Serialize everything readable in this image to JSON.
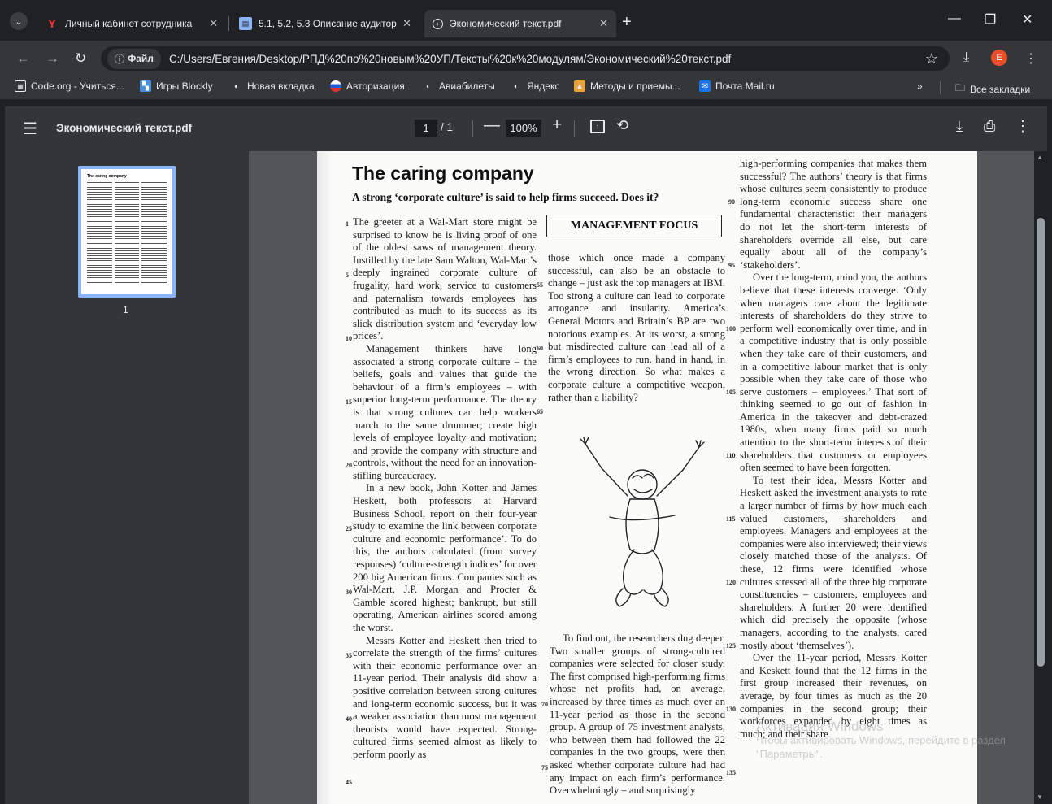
{
  "tabs": [
    {
      "label": "Личный кабинет сотрудника",
      "icon": "yandex-y-icon"
    },
    {
      "label": "5.1, 5.2, 5.3 Описание аудитор",
      "icon": "doc-icon"
    },
    {
      "label": "Экономический текст.pdf",
      "icon": "globe-icon"
    }
  ],
  "address": {
    "chip_label": "Файл",
    "url": "C:/Users/Евгения/Desktop/РПД%20по%20новым%20УП/Тексты%20к%20модулям/Экономический%20текст.pdf",
    "profile_initial": "E"
  },
  "bookmarks": [
    "Code.org - Учиться...",
    "Игры Blockly",
    "Новая вкладка",
    "Авторизация",
    "Авиабилеты",
    "Яндекс",
    "Методы и приемы...",
    "Почта Mail.ru"
  ],
  "bookmarks_more": "»",
  "bookmarks_all": "Все закладки",
  "pdf": {
    "filename": "Экономический текст.pdf",
    "page_current": "1",
    "page_total": "/ 1",
    "zoom": "100%",
    "thumb_page": "1"
  },
  "document": {
    "title": "The caring company",
    "subtitle": "A strong ‘corporate culture’ is said to help firms succeed. Does it?",
    "box_label": "MANAGEMENT FOCUS",
    "col1": [
      "The greeter at a Wal-Mart store might be surprised to know he is living proof of one of the oldest saws of management theory. Instilled by the late Sam Walton, Wal-Mart’s deeply ingrained corporate culture of frugality, hard work, service to customers and paternalism towards employees has contributed as much to its success as its slick distribution system and ‘everyday low prices’.",
      "Management thinkers have long associated a strong corporate culture – the beliefs, goals and values that guide the behaviour of a firm’s employees – with superior long-term performance. The theory is that strong cultures can help workers march to the same drummer; create high levels of employee loyalty and motivation; and provide the company with structure and controls, without the need for an innovation-stifling bureaucracy.",
      "In a new book, John Kotter and James Heskett, both professors at Harvard Business School, report on their four-year study to examine the link between corporate culture and economic performance’. To do this, the authors calculated (from survey responses) ‘culture-strength indices’ for over 200 big American firms. Companies such as Wal-Mart, J.P. Morgan and Procter & Gamble scored highest; bankrupt, but still operating, American airlines scored among the worst.",
      "Messrs Kotter and Heskett then tried to correlate the strength of the firms’ cultures with their economic performance over an 11-year period. Their analysis did show a positive correlation between strong cultures and long-term economic success, but it was a weaker association than most management theorists would have expected. Strong-cultured firms seemed almost as likely to perform poorly as"
    ],
    "col2a": "those which once made a company successful, can also be an obstacle to change – just ask the top managers at IBM. Too strong a culture can lead to corporate arrogance and insularity. America’s General Motors and Britain’s BP are two notorious examples. At its worst, a strong but misdirected culture can lead all of a firm’s employees to run, hand in hand, in the wrong direction. So what makes a corporate culture a competitive weapon, rather than a liability?",
    "col2b": "To find out, the researchers dug deeper. Two smaller groups of strong-cultured companies were selected for closer study. The first comprised high-performing firms whose net profits had, on average, increased by three times as much over an 11-year period as those in the second group. A group of 75 investment analysts, who between them had followed the 22 companies in the two groups, were then asked whether corporate culture had had any impact on each firm’s performance. Overwhelmingly – and surprisingly",
    "col3": [
      "high-performing companies that makes them successful? The authors’ theory is that firms whose cultures seem consistently to produce long-term economic success share one fundamental characteristic: their managers do not let the short-term interests of shareholders override all else, but care equally about all of the company’s ‘stakeholders’.",
      "Over the long-term, mind you, the authors believe that these interests converge. ‘Only when managers care about the legitimate interests of shareholders do they strive to perform well economically over time, and in a competitive industry that is only possible when they take care of their customers, and in a competitive labour market that is only possible when they take care of those who serve customers – employees.’ That sort of thinking seemed to go out of fashion in America in the takeover and debt-crazed 1980s, when many firms paid so much attention to the short-term interests of their shareholders that customers or employees often seemed to have been forgotten.",
      "To test their idea, Messrs Kotter and Heskett asked the investment analysts to rate a larger number of firms by how much each valued customers, shareholders and employees. Managers and employees at the companies were also interviewed; their views closely matched those of the analysts. Of these, 12 firms were identified whose cultures stressed all of the three big corporate constituencies – customers, employees and shareholders. A further 20 were identified which did precisely the opposite (whose managers, according to the analysts, cared mostly about ‘themselves’).",
      "Over the 11-year period, Messrs Kotter and Keskett found that the 12 firms in the first group increased their revenues, on average, by four times as much as the 20 companies in the second group; their workforces expanded by eight times as much; and their share"
    ],
    "line_numbers_left": [
      "1",
      "5",
      "10",
      "15",
      "20",
      "25",
      "30",
      "35",
      "40",
      "45"
    ],
    "line_numbers_mid": [
      "55",
      "60",
      "65",
      "70",
      "75"
    ],
    "line_numbers_right": [
      "90",
      "95",
      "100",
      "105",
      "110",
      "115",
      "120",
      "125",
      "130",
      "135"
    ]
  },
  "watermark": {
    "line1": "Активация Windows",
    "line2": "Чтобы активировать Windows, перейдите в раздел \"Параметры\"."
  },
  "colors": {
    "accent": "#8ab4f8",
    "toolbar": "#323639",
    "viewer_bg": "#525659",
    "profile": "#e8502a"
  }
}
